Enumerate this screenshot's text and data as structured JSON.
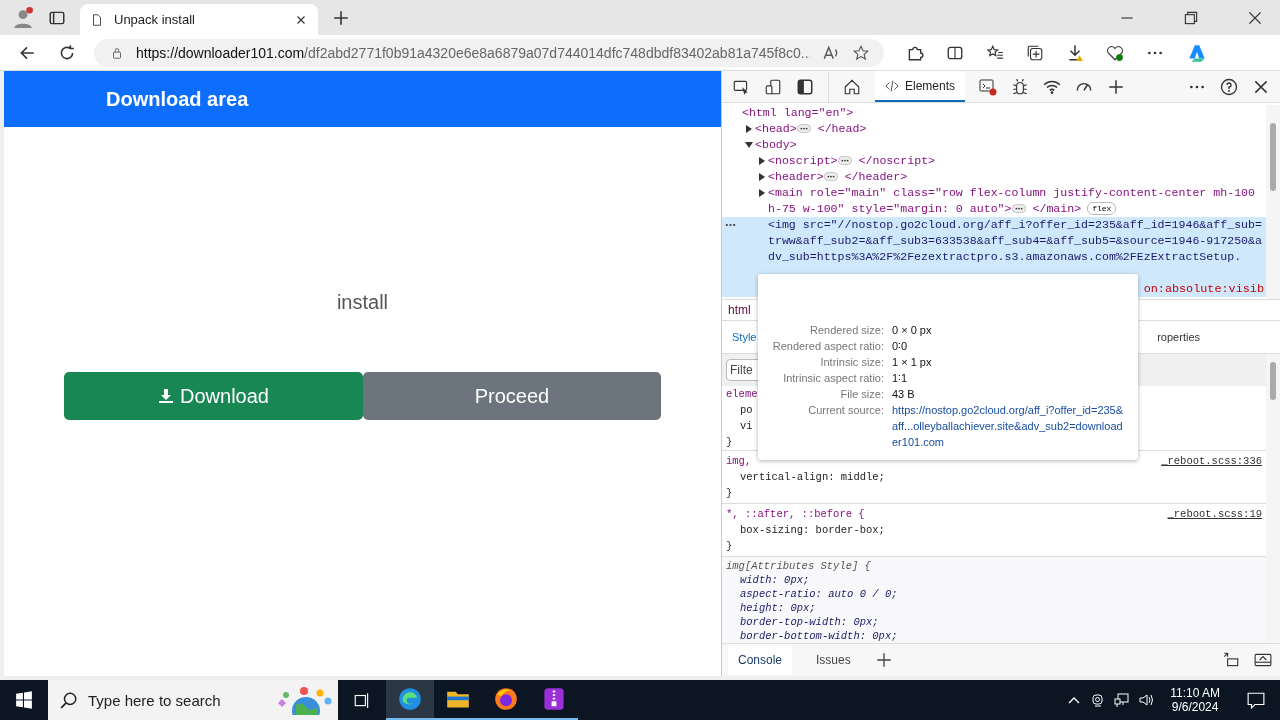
{
  "browser": {
    "tabs": [
      {
        "title": "Unpack install",
        "selected": true
      }
    ],
    "address": {
      "host": "https://downloader101.com",
      "path": "/df2abd2771f0b91a4320e6e8a6879a07d744014dfc748dbdf83402ab81a745f8c0..."
    }
  },
  "page": {
    "title": "Download area",
    "caption": "install",
    "buttons": [
      {
        "label": "Download",
        "kind": "primary"
      },
      {
        "label": "Proceed",
        "kind": "secondary"
      }
    ]
  },
  "devtools": {
    "tabs": [
      {
        "label": "Elements",
        "selected": true
      }
    ],
    "dom_tree": [
      {
        "open": "<html lang=\"en\">",
        "children": [
          {
            "open": "<head>",
            "close": "</head>",
            "expanded": false
          },
          {
            "open": "<body>",
            "expanded": true,
            "children": [
              {
                "open": "<noscript>",
                "close": "</noscript>",
                "expanded": false
              },
              {
                "open": "<header>",
                "close": "</header>",
                "expanded": false
              },
              {
                "open": "<main role=\"main\" class=\"row flex-column justify-content-center mh-100 h-75 w-100\" style=\"margin: 0 auto\">",
                "close": "</main>",
                "expanded": false,
                "badge": "flex"
              },
              {
                "open": "<img src=\"//nostop.go2cloud.org/aff_i?offer_id=235&aff_id=1946&aff_sub=trww&aff_sub2=&aff_sub3=633538&aff_sub4=&aff_sub5=&source=1946-917250&adv_sub=https%3A%2F%2Fezextractpro.s3.amazonaws.com%2FEzExtractSetup.",
                "selected": true,
                "tail": "on:absolute:visib"
              }
            ]
          }
        ]
      }
    ],
    "breadcrumb": "html",
    "style_tabs": [
      {
        "label": "Style",
        "selected": true
      },
      {
        "label": "roperties",
        "selected": false
      }
    ],
    "filter": {
      "placeholder": "Filte"
    },
    "rules": [
      {
        "selector": "eleme",
        "declarations": [
          "po",
          "vi"
        ],
        "end": "}"
      },
      {
        "selector": "img,",
        "source": "_reboot.scss:336",
        "declarations": [
          "vertical-align: middle;"
        ],
        "end": "}"
      },
      {
        "selector": "*, ::after, ::before {",
        "source": "_reboot.scss:19",
        "declarations": [
          "box-sizing: border-box;"
        ],
        "end": "}"
      },
      {
        "selector": "img[Attributes Style] {",
        "kind": "attributes",
        "declarations": [
          "width: 0px;",
          "aspect-ratio: auto 0 / 0;",
          "height: 0px;",
          "border-top-width: 0px;",
          "border-bottom-width: 0px;"
        ]
      }
    ],
    "tooltip": {
      "rows": [
        {
          "label": "Rendered size:",
          "value": "0 × 0 px"
        },
        {
          "label": "Rendered aspect ratio:",
          "value": "0∶0"
        },
        {
          "label": "Intrinsic size:",
          "value": "1 × 1 px"
        },
        {
          "label": "Intrinsic aspect ratio:",
          "value": "1∶1"
        },
        {
          "label": "File size:",
          "value": "43 B"
        },
        {
          "label": "Current source:",
          "value": "https://nostop.go2cloud.org/aff_i?offer_id=235&aff...olleyballachiever.site&adv_sub2=downloader101.com",
          "kind": "link"
        }
      ]
    },
    "drawer_tabs": [
      {
        "label": "Console",
        "selected": true
      },
      {
        "label": "Issues",
        "selected": false
      }
    ]
  },
  "taskbar": {
    "search_placeholder": "Type here to search",
    "apps": [
      {
        "kind": "edge",
        "active": true
      },
      {
        "kind": "explorer",
        "active": false
      },
      {
        "kind": "firefox",
        "active": false
      },
      {
        "kind": "archiver",
        "active": false
      }
    ],
    "time": "11:10 AM",
    "date": "9/6/2024"
  }
}
